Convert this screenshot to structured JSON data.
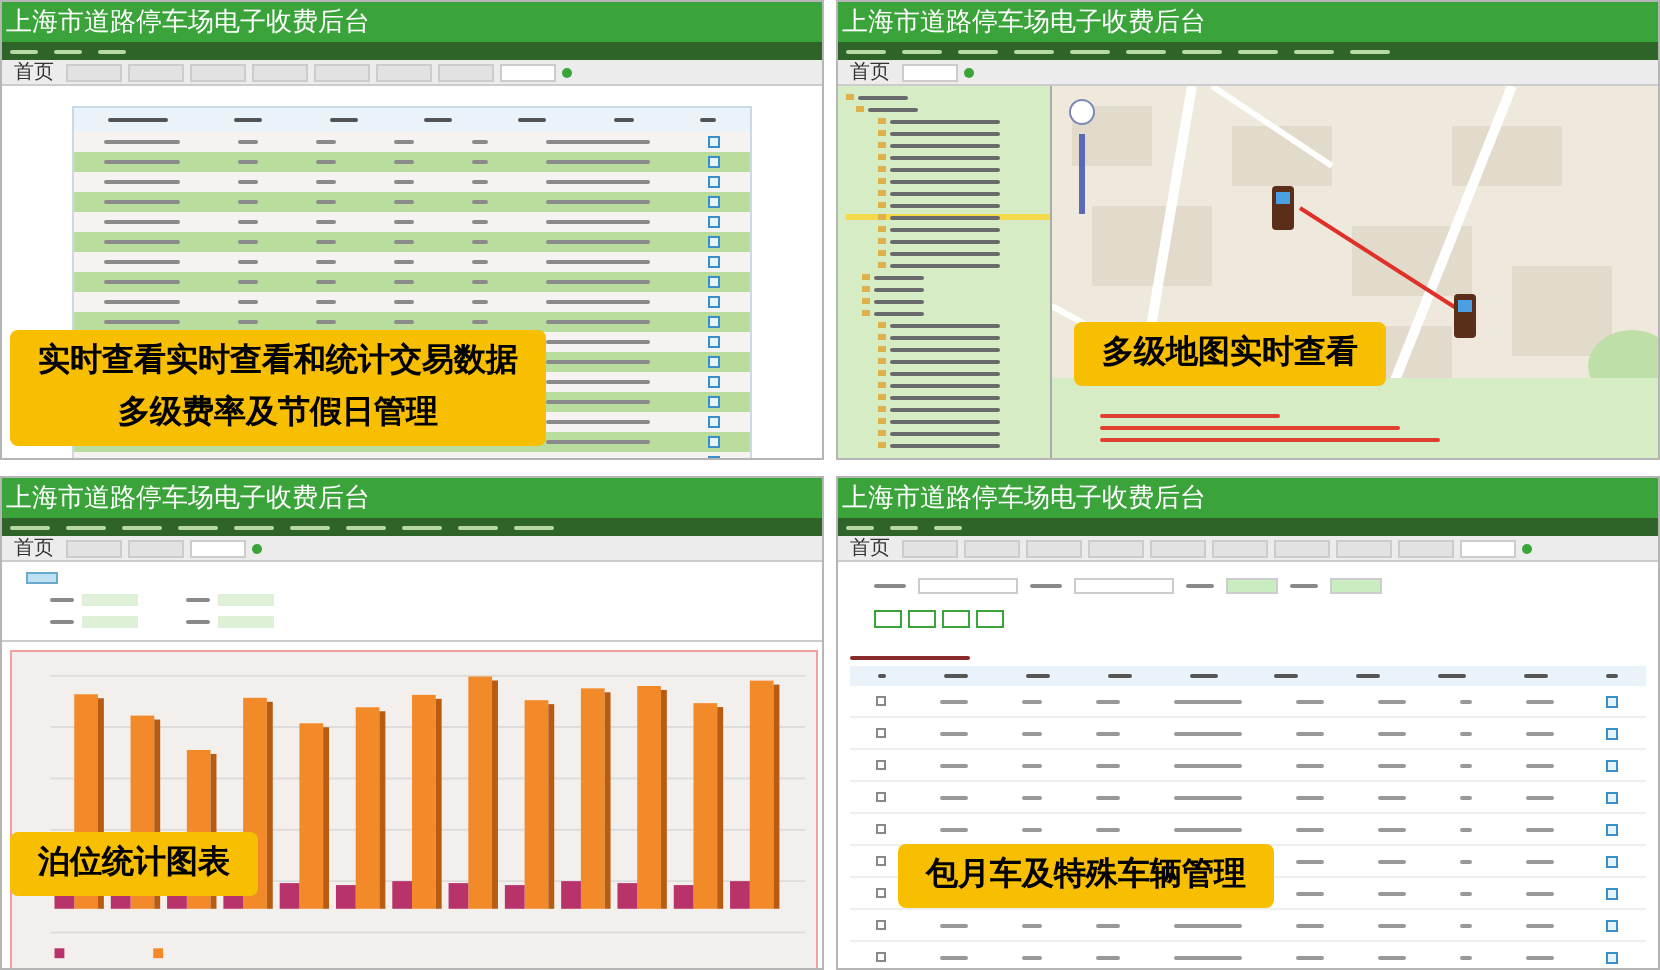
{
  "panels": [
    {
      "kind": "rate_table",
      "title": "上海市道路停车场电子收费后台",
      "home_tab": "首页",
      "tabs": [
        {
          "selected": false
        },
        {
          "selected": false
        },
        {
          "selected": false
        },
        {
          "selected": false
        },
        {
          "selected": false
        },
        {
          "selected": false
        },
        {
          "selected": false
        },
        {
          "selected": true
        }
      ],
      "captions": [
        "实时查看实时查看和统计交易数据",
        "多级费率及节假日管理"
      ]
    },
    {
      "kind": "map",
      "title": "上海市道路停车场电子收费后台",
      "home_tab": "首页",
      "tabs": [
        {
          "selected": true
        }
      ],
      "tree": [
        {
          "selected": false
        },
        {
          "selected": false
        },
        {
          "selected": false
        },
        {
          "selected": false
        },
        {
          "selected": false
        },
        {
          "selected": false
        },
        {
          "selected": false
        },
        {
          "selected": false
        },
        {
          "selected": false
        },
        {
          "selected": false
        },
        {
          "selected": true
        },
        {
          "selected": false
        },
        {
          "selected": false
        },
        {
          "selected": false
        },
        {
          "selected": false
        },
        {
          "selected": false
        },
        {
          "selected": false
        },
        {
          "selected": false
        },
        {
          "selected": false
        },
        {
          "selected": false
        },
        {
          "selected": false
        },
        {
          "selected": false
        },
        {
          "selected": false
        },
        {
          "selected": false
        },
        {
          "selected": false
        },
        {
          "selected": false
        },
        {
          "selected": false
        },
        {
          "selected": false
        },
        {
          "selected": false
        },
        {
          "selected": false
        }
      ],
      "captions": [
        "多级地图实时查看"
      ]
    },
    {
      "kind": "chart",
      "title": "上海市道路停车场电子收费后台",
      "home_tab": "首页",
      "tabs": [
        {
          "selected": false
        },
        {
          "selected": false
        },
        {
          "selected": true
        }
      ],
      "captions": [
        "泊位统计图表"
      ]
    },
    {
      "kind": "monthly_table",
      "title": "上海市道路停车场电子收费后台",
      "home_tab": "首页",
      "tabs": [
        {
          "selected": false
        },
        {
          "selected": false
        },
        {
          "selected": false
        },
        {
          "selected": false
        },
        {
          "selected": false
        },
        {
          "selected": false
        },
        {
          "selected": false
        },
        {
          "selected": false
        },
        {
          "selected": false
        },
        {
          "selected": true
        }
      ],
      "rows": [
        {
          "checked": false
        },
        {
          "checked": false
        },
        {
          "checked": false
        },
        {
          "checked": false
        },
        {
          "checked": false
        },
        {
          "checked": false
        },
        {
          "checked": false
        },
        {
          "checked": false
        },
        {
          "checked": false
        }
      ],
      "captions": [
        "包月车及特殊车辆管理"
      ]
    }
  ]
}
